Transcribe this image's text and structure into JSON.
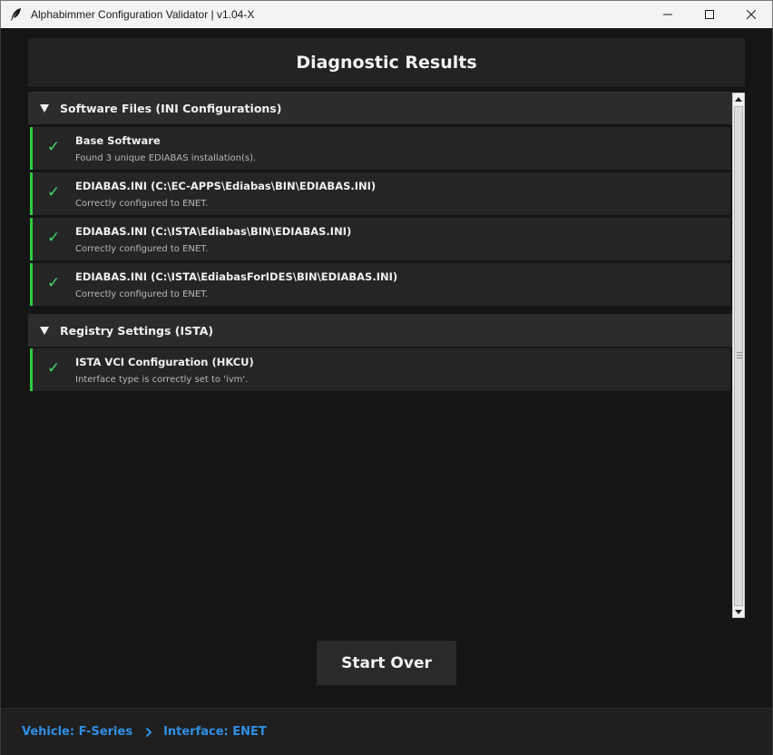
{
  "window": {
    "title": "Alphabimmer Configuration Validator | v1.04-X",
    "controls": [
      "minimize-icon",
      "maximize-icon",
      "close-icon"
    ]
  },
  "header": {
    "title": "Diagnostic Results"
  },
  "sections": [
    {
      "title": "Software Files (INI Configurations)",
      "expanded": true,
      "items": [
        {
          "status": "pass",
          "icon": "checkmark-icon",
          "title": "Base Software",
          "description": "Found 3 unique EDIABAS installation(s)."
        },
        {
          "status": "pass",
          "icon": "checkmark-icon",
          "title": "EDIABAS.INI (C:\\EC-APPS\\Ediabas\\BIN\\EDIABAS.INI)",
          "description": "Correctly configured to ENET."
        },
        {
          "status": "pass",
          "icon": "checkmark-icon",
          "title": "EDIABAS.INI (C:\\ISTA\\Ediabas\\BIN\\EDIABAS.INI)",
          "description": "Correctly configured to ENET."
        },
        {
          "status": "pass",
          "icon": "checkmark-icon",
          "title": "EDIABAS.INI (C:\\ISTA\\EdiabasForIDES\\BIN\\EDIABAS.INI)",
          "description": "Correctly configured to ENET."
        }
      ]
    },
    {
      "title": "Registry Settings (ISTA)",
      "expanded": true,
      "items": [
        {
          "status": "pass",
          "icon": "checkmark-icon",
          "title": "ISTA VCI Configuration (HKCU)",
          "description": "Interface type is correctly set to 'ivm'."
        }
      ]
    }
  ],
  "actions": {
    "start_over_label": "Start Over"
  },
  "footer": {
    "vehicle": "Vehicle: F-Series",
    "separator_icon": "chevron-right-icon",
    "interface": "Interface: ENET"
  },
  "colors": {
    "background": "#151515",
    "panel": "#232323",
    "section_header": "#2c2c2c",
    "item": "#252525",
    "pass_accent": "#2ecc40",
    "check": "#3fd96a",
    "link_blue": "#2f8fe6"
  }
}
